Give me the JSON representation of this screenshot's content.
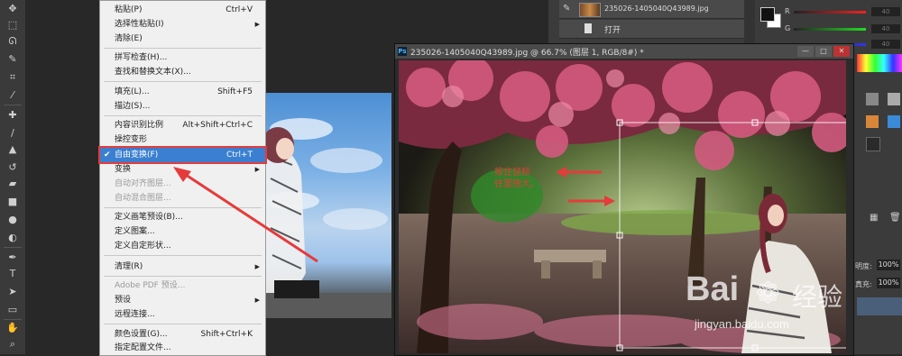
{
  "toolbar": {
    "tools": [
      "move-icon",
      "marquee-icon",
      "lasso-icon",
      "quick-select-icon",
      "crop-icon",
      "eyedropper-icon",
      "healing-brush-icon",
      "brush-icon",
      "clone-stamp-icon",
      "history-brush-icon",
      "eraser-icon",
      "gradient-icon",
      "blur-icon",
      "dodge-icon",
      "pen-icon",
      "type-icon",
      "path-select-icon",
      "shape-icon",
      "hand-icon",
      "zoom-icon"
    ]
  },
  "menu": {
    "items": [
      {
        "label": "粘贴(P)",
        "shortcut": "Ctrl+V"
      },
      {
        "label": "选择性粘贴(I)",
        "submenu": "▶"
      },
      {
        "label": "清除(E)"
      },
      {
        "label": "拼写检查(H)..."
      },
      {
        "label": "查找和替换文本(X)..."
      },
      {
        "label": "填充(L)...",
        "shortcut": "Shift+F5"
      },
      {
        "label": "描边(S)..."
      },
      {
        "label": "内容识别比例",
        "shortcut": "Alt+Shift+Ctrl+C"
      },
      {
        "label": "操控变形"
      },
      {
        "label": "自由变换(F)",
        "shortcut": "Ctrl+T",
        "check": "✔"
      },
      {
        "label": "变换",
        "submenu": "▶"
      },
      {
        "label": "自动对齐图层..."
      },
      {
        "label": "自动混合图层..."
      },
      {
        "label": "定义画笔预设(B)..."
      },
      {
        "label": "定义图案..."
      },
      {
        "label": "定义自定形状..."
      },
      {
        "label": "清理(R)",
        "submenu": "▶"
      },
      {
        "label": "Adobe PDF 预设..."
      },
      {
        "label": "预设",
        "submenu": "▶"
      },
      {
        "label": "远程连接..."
      },
      {
        "label": "颜色设置(G)...",
        "shortcut": "Shift+Ctrl+K"
      },
      {
        "label": "指定配置文件..."
      }
    ]
  },
  "layers": {
    "row1": {
      "name": "235026-1405040Q43989.jpg"
    },
    "row2": {
      "name": "打开"
    }
  },
  "color_panel": {
    "r_label": "R",
    "g_label": "G",
    "b_label": "B",
    "r_value": "40",
    "g_value": "40",
    "b_value": "40"
  },
  "document": {
    "title": "235026-1405040Q43989.jpg @ 66.7% (图层 1, RGB/8#) *",
    "ps_logo": "Ps",
    "min": "—",
    "max": "□",
    "close": "✕",
    "annotation_text": "按住鼠标\n往里拖大。",
    "annotation_line1": "按住鼠标",
    "annotation_line2": "往里拖大。"
  },
  "right_props": {
    "opacity_label": "明度:",
    "opacity_value": "100%",
    "fill_label": "真充:",
    "fill_value": "100%"
  },
  "watermark": {
    "brand": "Bai",
    "brand2": "经验",
    "url": "jingyan.baidu.com"
  },
  "colors": {
    "highlight": "#3a7fd0",
    "annotation_red": "#e53b3b",
    "menu_bg": "#f0f0f0"
  }
}
